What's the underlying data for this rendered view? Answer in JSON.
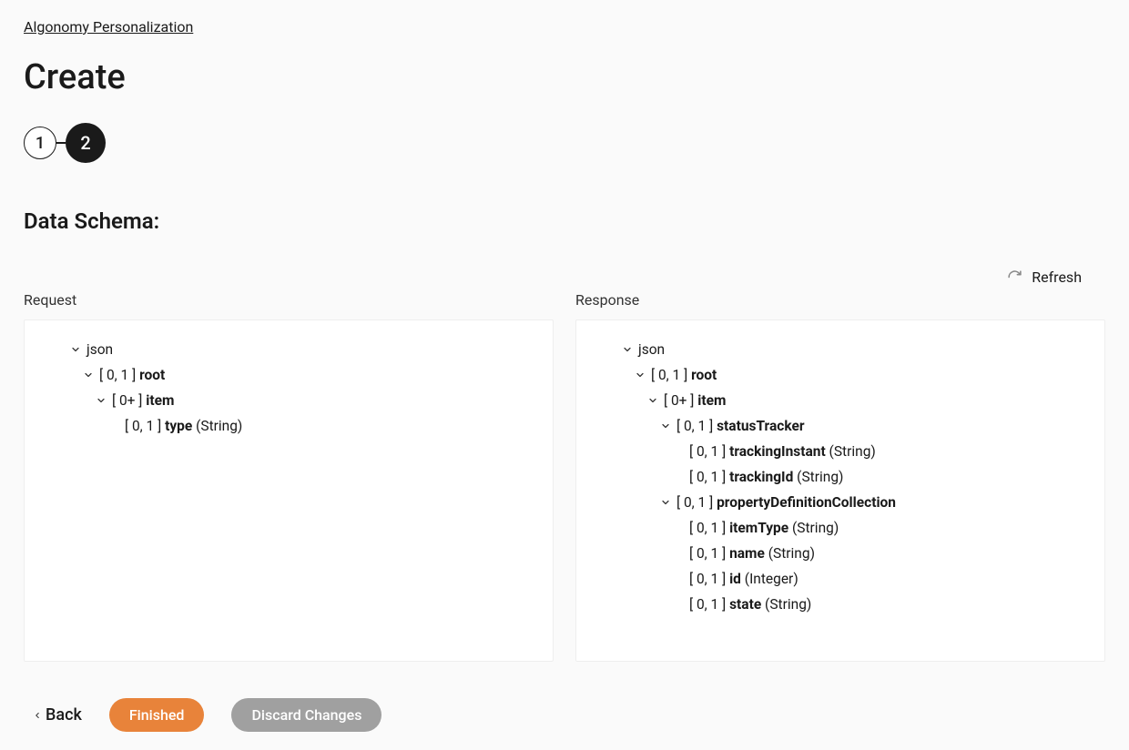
{
  "breadcrumb": "Algonomy Personalization",
  "page_title": "Create",
  "steps": [
    "1",
    "2"
  ],
  "section_title": "Data Schema:",
  "refresh_label": "Refresh",
  "panels": {
    "request": {
      "header": "Request",
      "tree": [
        {
          "indent": 0,
          "chev": true,
          "card": "",
          "name": "json",
          "type": ""
        },
        {
          "indent": 1,
          "chev": true,
          "card": "[ 0, 1 ]",
          "name": "root",
          "type": ""
        },
        {
          "indent": 2,
          "chev": true,
          "card": "[ 0+ ]",
          "name": "item",
          "type": ""
        },
        {
          "indent": 3,
          "chev": false,
          "card": "[ 0, 1 ]",
          "name": "type",
          "type": "(String)"
        }
      ]
    },
    "response": {
      "header": "Response",
      "tree": [
        {
          "indent": 0,
          "chev": true,
          "card": "",
          "name": "json",
          "type": ""
        },
        {
          "indent": 1,
          "chev": true,
          "card": "[ 0, 1 ]",
          "name": "root",
          "type": ""
        },
        {
          "indent": 2,
          "chev": true,
          "card": "[ 0+ ]",
          "name": "item",
          "type": ""
        },
        {
          "indent": 3,
          "chev": true,
          "card": "[ 0, 1 ]",
          "name": "statusTracker",
          "type": ""
        },
        {
          "indent": 4,
          "chev": false,
          "card": "[ 0, 1 ]",
          "name": "trackingInstant",
          "type": "(String)"
        },
        {
          "indent": 4,
          "chev": false,
          "card": "[ 0, 1 ]",
          "name": "trackingId",
          "type": "(String)"
        },
        {
          "indent": 3,
          "chev": true,
          "card": "[ 0, 1 ]",
          "name": "propertyDefinitionCollection",
          "type": ""
        },
        {
          "indent": 4,
          "chev": false,
          "card": "[ 0, 1 ]",
          "name": "itemType",
          "type": "(String)"
        },
        {
          "indent": 4,
          "chev": false,
          "card": "[ 0, 1 ]",
          "name": "name",
          "type": "(String)"
        },
        {
          "indent": 4,
          "chev": false,
          "card": "[ 0, 1 ]",
          "name": "id",
          "type": "(Integer)"
        },
        {
          "indent": 4,
          "chev": false,
          "card": "[ 0, 1 ]",
          "name": "state",
          "type": "(String)"
        }
      ]
    }
  },
  "footer": {
    "back": "Back",
    "finished": "Finished",
    "discard": "Discard Changes"
  }
}
